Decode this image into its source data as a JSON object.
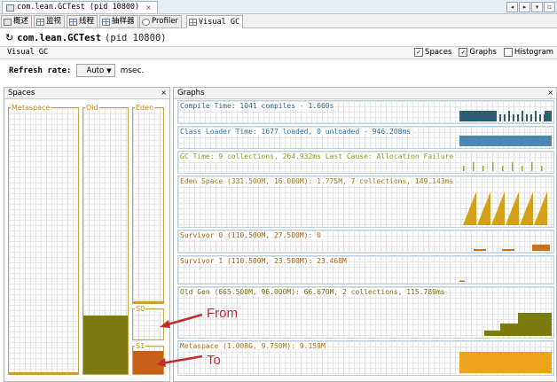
{
  "window": {
    "document_tab": "com.lean.GCTest (pid 10800)",
    "close_glyph": "×",
    "window_buttons": [
      "◂",
      "▸",
      "▾",
      "▫"
    ]
  },
  "subtabs": [
    "概述",
    "监视",
    "线程",
    "抽样器",
    "Profiler",
    "Visual GC"
  ],
  "app": {
    "title": "com.lean.GCTest",
    "pid": "(pid 10800)"
  },
  "visual_gc": {
    "label": "Visual GC",
    "checkboxes": [
      {
        "label": "Spaces",
        "checked": true
      },
      {
        "label": "Graphs",
        "checked": true
      },
      {
        "label": "Histogram",
        "checked": false
      }
    ]
  },
  "refresh": {
    "label": "Refresh rate:",
    "value": "Auto",
    "unit": "msec."
  },
  "spaces_panel": {
    "title": "Spaces",
    "close": "×",
    "metaspace": "Metaspace",
    "old": "Old",
    "eden": "Eden",
    "s0": "S0",
    "s1": "S1",
    "old_fill_fraction": 0.22,
    "s1_fill_fraction": 0.85
  },
  "graphs_panel": {
    "title": "Graphs",
    "close": "×",
    "rows": [
      {
        "text": "Compile Time: 1041 compiles - 1.660s",
        "color": "#2a5f80",
        "plot": "#2f5d76"
      },
      {
        "text": "Class Loader Time: 1677 loaded, 0 unloaded - 946.208ms",
        "color": "#2a6fa8",
        "plot": "#4a86b5"
      },
      {
        "text": "GC Time: 9 collections, 264.932ms Last Cause: Allocation Failure",
        "color": "#8a9a1a",
        "plot": "#8db02a"
      },
      {
        "text": "Eden Space (331.500M, 16.000M): 1.775M, 7 collections, 149.143ms",
        "color": "#a87a10",
        "plot": "#d4a017"
      },
      {
        "text": "Survivor 0 (110.500M, 27.500M): 0",
        "color": "#a05e10",
        "plot": "#c8701a"
      },
      {
        "text": "Survivor 1 (110.500M, 23.500M): 23.468M",
        "color": "#a05e10",
        "plot": "#c8701a"
      },
      {
        "text": "Old Gen (665.500M, 96.000M): 66.670M, 2 collections, 115.789ms",
        "color": "#6e6e10",
        "plot": "#7b7b10"
      },
      {
        "text": "Metaspace (1.008G, 9.750M): 9.159M",
        "color": "#b07010",
        "plot": "#eca21a"
      }
    ]
  },
  "annotations": {
    "from": "From",
    "to": "To"
  },
  "colors": {
    "annotation": "#c62a2a",
    "old_fill": "#7b7b10",
    "s1_fill": "#c8601a"
  }
}
